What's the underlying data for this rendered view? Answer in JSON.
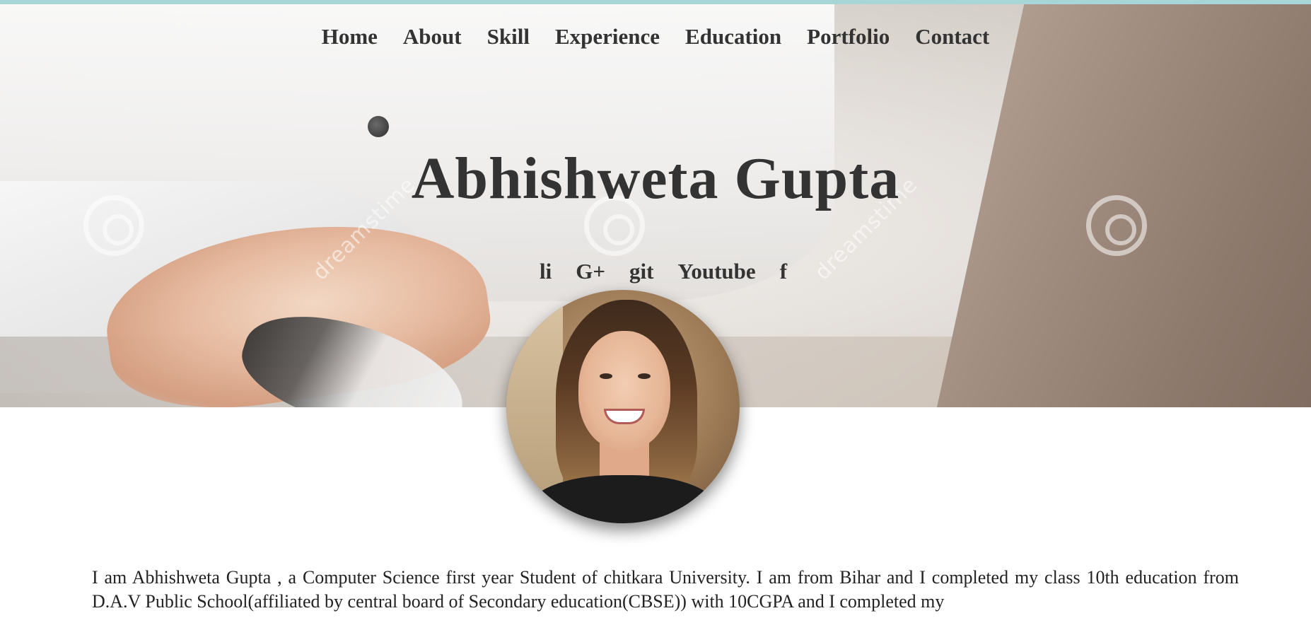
{
  "nav": {
    "items": [
      {
        "label": "Home"
      },
      {
        "label": "About"
      },
      {
        "label": "Skill"
      },
      {
        "label": "Experience"
      },
      {
        "label": "Education"
      },
      {
        "label": "Portfolio"
      },
      {
        "label": "Contact"
      }
    ]
  },
  "hero": {
    "title": "Abhishweta Gupta",
    "watermark": "dreamstime"
  },
  "social": {
    "links": [
      {
        "label": "li"
      },
      {
        "label": "G+"
      },
      {
        "label": "git"
      },
      {
        "label": "Youtube"
      },
      {
        "label": "f"
      }
    ]
  },
  "about": {
    "text": "I am Abhishweta Gupta , a Computer Science first year Student of chitkara University. I am from Bihar and I completed my class 10th education from D.A.V Public School(affiliated by central board of Secondary education(CBSE)) with 10CGPA and I completed my"
  }
}
